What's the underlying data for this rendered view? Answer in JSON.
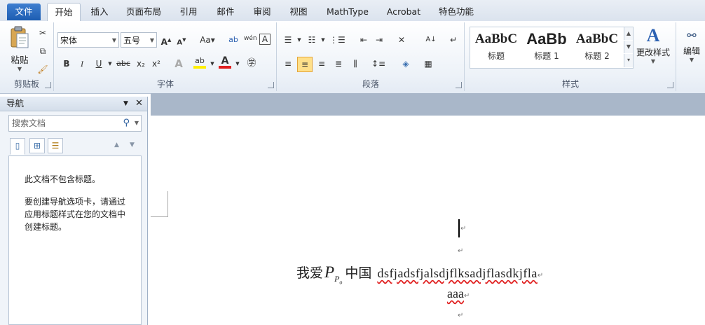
{
  "tabs": {
    "file": "文件",
    "home": "开始",
    "insert": "插入",
    "layout": "页面布局",
    "references": "引用",
    "mailings": "邮件",
    "review": "审阅",
    "view": "视图",
    "mathtype": "MathType",
    "acrobat": "Acrobat",
    "special": "特色功能"
  },
  "ribbon": {
    "clipboard": {
      "label": "剪贴板",
      "paste": "粘贴"
    },
    "font": {
      "label": "字体",
      "font_name": "宋体",
      "font_size": "五号",
      "grow": "A",
      "shrink": "A",
      "change_case": "Aa",
      "bold": "B",
      "italic": "I",
      "underline": "U",
      "strike": "abc",
      "subscript": "x₂",
      "superscript": "x²",
      "highlight": "ab",
      "color": "A",
      "phonetic": "wén"
    },
    "paragraph": {
      "label": "段落"
    },
    "styles": {
      "label": "样式",
      "items": [
        {
          "sample": "AaBbC",
          "name": "标题"
        },
        {
          "sample": "AaBb",
          "name": "标题 1"
        },
        {
          "sample": "AaBbC",
          "name": "标题 2"
        }
      ],
      "change_styles": "更改样式"
    },
    "editing": {
      "label": "编辑"
    }
  },
  "nav": {
    "title": "导航",
    "search_placeholder": "搜索文档",
    "msg1": "此文档不包含标题。",
    "msg2": "要创建导航选项卡，请通过应用标题样式在您的文档中创建标题。"
  },
  "doc": {
    "text_prefix": "我爱",
    "math_main": "P",
    "math_sub": "P",
    "text_mid": "中国",
    "text_latin": "dsfjadsfjalsdjflksadjflasdkjfla",
    "line2": "aaa"
  }
}
